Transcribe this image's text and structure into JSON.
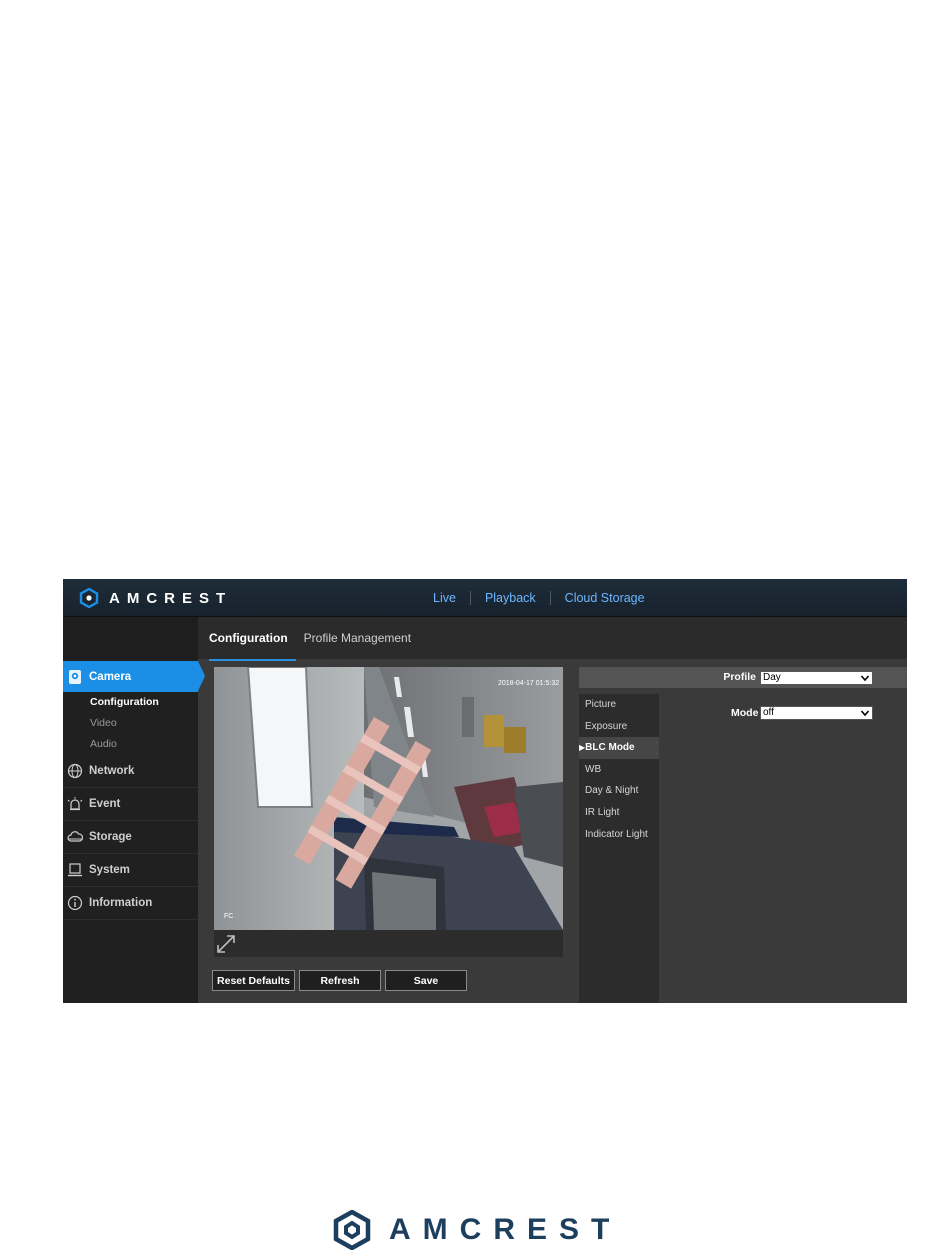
{
  "brand": {
    "name": "AMCREST",
    "accent": "#1b8fe6"
  },
  "top_nav": {
    "items": [
      "Live",
      "Playback",
      "Cloud Storage"
    ]
  },
  "sub_tabs": [
    {
      "label": "Configuration",
      "active": true
    },
    {
      "label": "Profile Management",
      "active": false
    }
  ],
  "sidebar": {
    "camera": {
      "label": "Camera",
      "icon": "camera-icon"
    },
    "camera_sub": [
      "Configuration",
      "Video",
      "Audio"
    ],
    "network": {
      "label": "Network",
      "icon": "globe-icon"
    },
    "event": {
      "label": "Event",
      "icon": "alarm-icon"
    },
    "storage": {
      "label": "Storage",
      "icon": "cloud-icon"
    },
    "system": {
      "label": "System",
      "icon": "laptop-icon"
    },
    "information": {
      "label": "Information",
      "icon": "info-icon"
    }
  },
  "video": {
    "timestamp": "2018-04-17 01:5:32",
    "channel": "FC"
  },
  "buttons": {
    "reset": "Reset Defaults",
    "refresh": "Refresh",
    "save": "Save"
  },
  "profile": {
    "label": "Profile",
    "value": "Day"
  },
  "settings_menu": [
    "Picture",
    "Exposure",
    "BLC Mode",
    "WB",
    "Day & Night",
    "IR Light",
    "Indicator Light"
  ],
  "active_setting": "BLC Mode",
  "mode": {
    "label": "Mode",
    "value": "off"
  },
  "footer": {
    "brand": "AMCREST"
  }
}
